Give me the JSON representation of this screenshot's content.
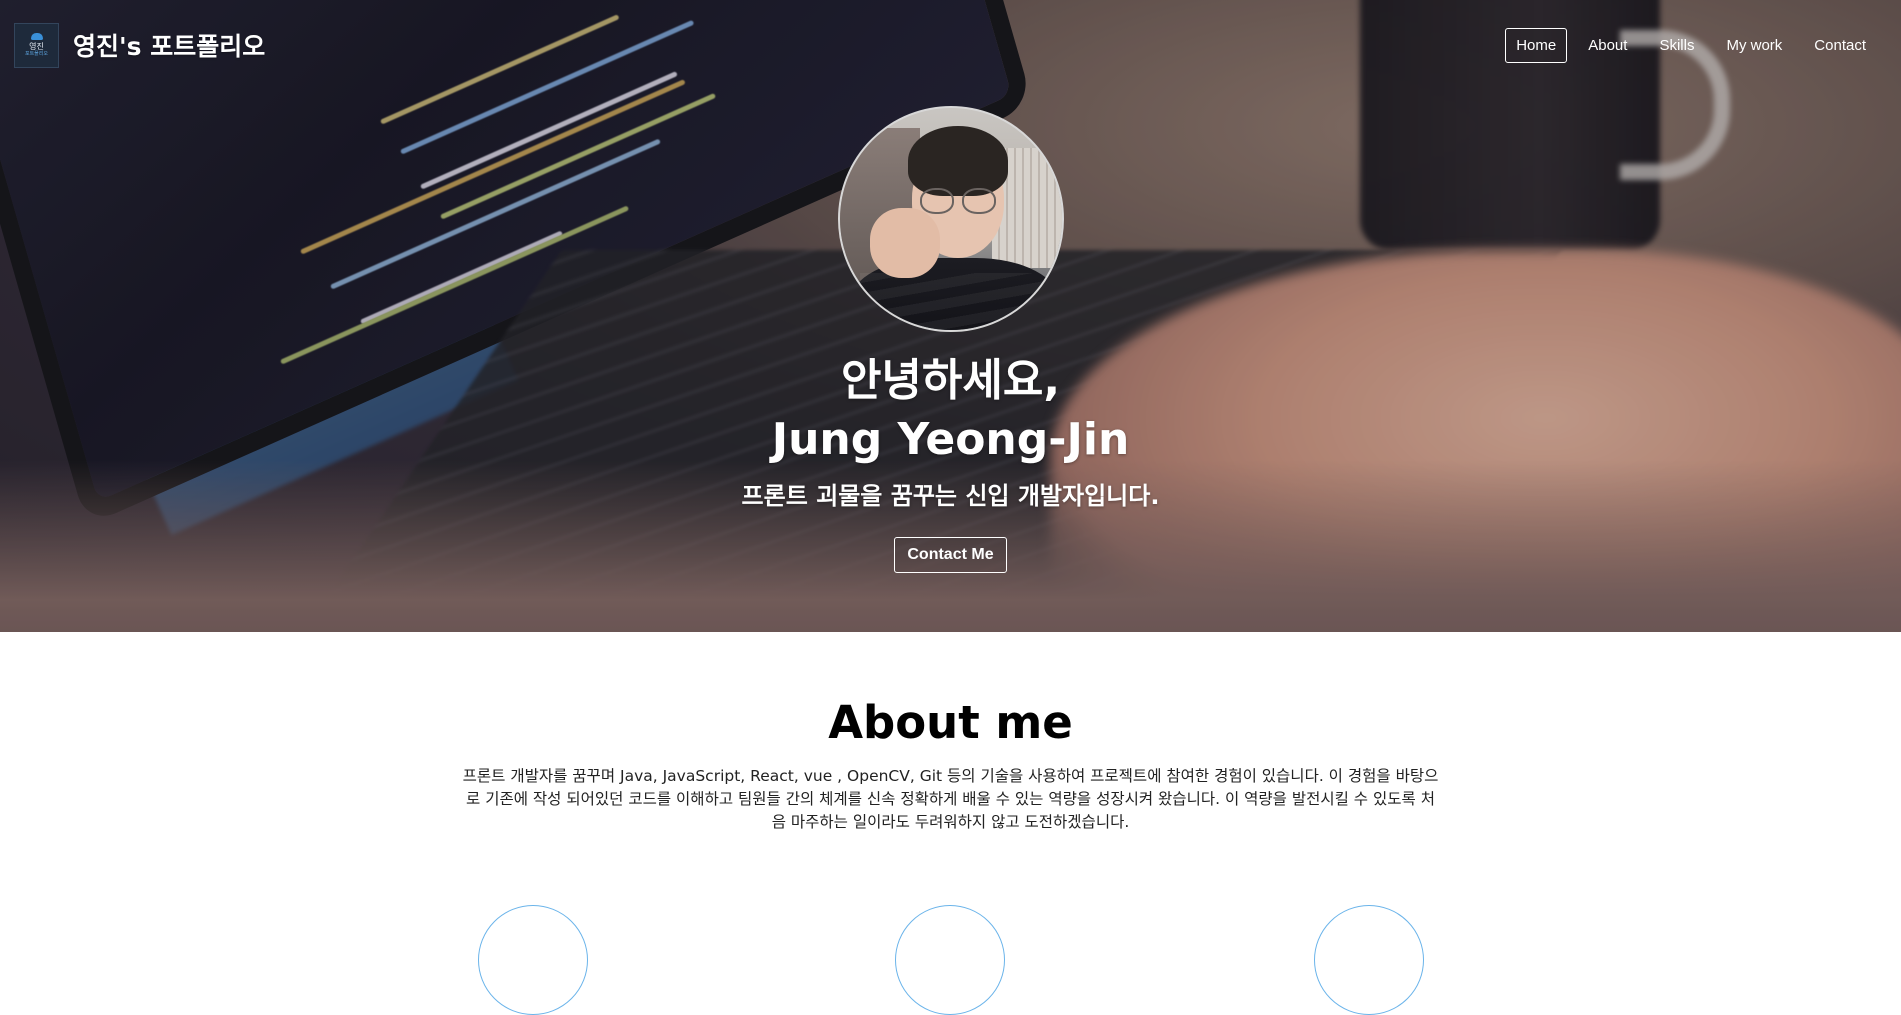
{
  "navbar": {
    "logo": {
      "name": "영진",
      "sub": "포트폴리오",
      "icon": "cloud-logo-icon"
    },
    "brand_title": "영진's 포트폴리오",
    "items": [
      {
        "label": "Home",
        "active": true
      },
      {
        "label": "About",
        "active": false
      },
      {
        "label": "Skills",
        "active": false
      },
      {
        "label": "My work",
        "active": false
      },
      {
        "label": "Contact",
        "active": false
      }
    ]
  },
  "hero": {
    "avatar_icon": "profile-photo",
    "greeting": "안녕하세요,",
    "name": "Jung Yeong-Jin",
    "tagline": "프론트 괴물을 꿈꾸는 신입 개발자입니다.",
    "contact_button": "Contact Me"
  },
  "about": {
    "title": "About me",
    "text": "프론트 개발자를 꿈꾸며 Java, JavaScript, React, vue , OpenCV, Git 등의 기술을 사용하여 프로젝트에 참여한 경험이 있습니다. 이 경험을 바탕으로 기존에 작성 되어있던 코드를 이해하고 팀원들 간의 체계를 신속 정확하게 배울 수 있는 역량을 성장시켜 왔습니다. 이 역량을 발전시킬 수 있도록 처음 마주하는 일이라도 두려워하지 않고 도전하겠습니다."
  },
  "colors": {
    "accent_circle": "#6bb4ea",
    "logo_bg": "#1e2a3b"
  }
}
